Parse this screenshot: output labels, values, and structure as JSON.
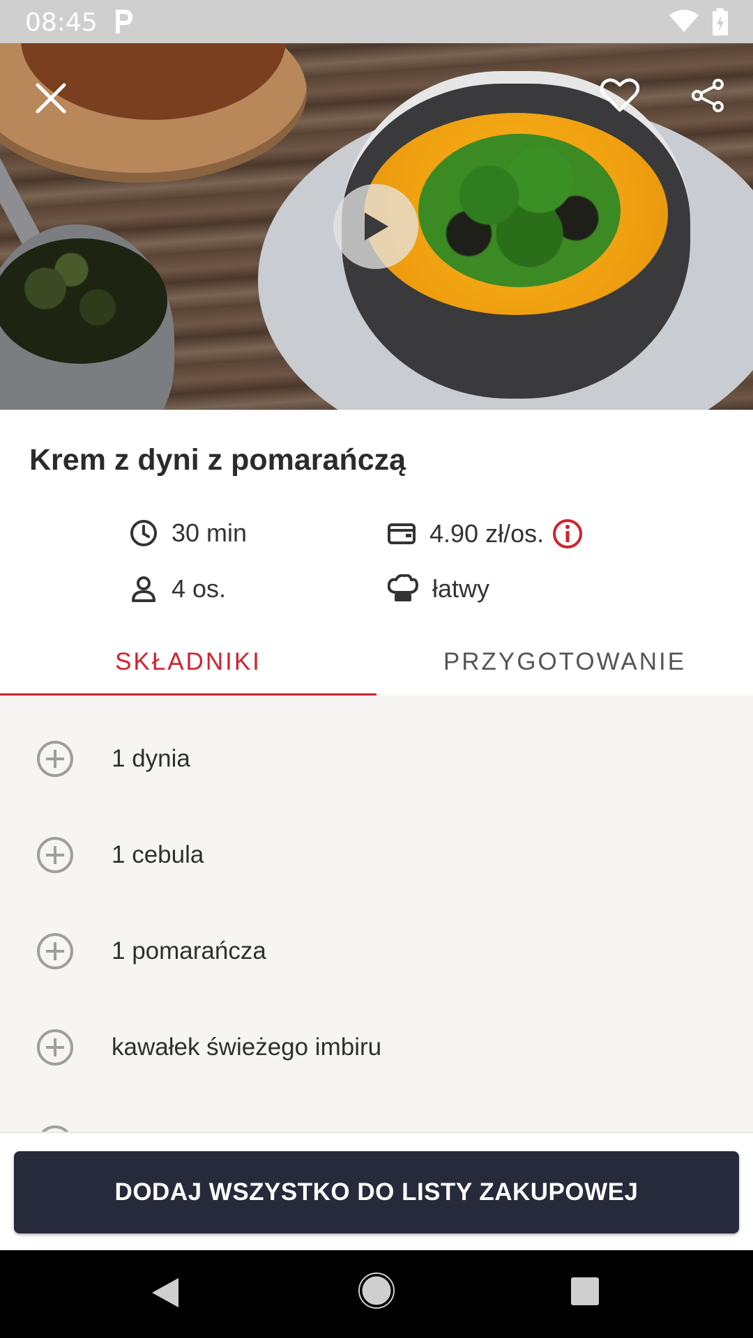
{
  "status_bar": {
    "time": "08:45"
  },
  "hero": {
    "close_icon": "close-icon",
    "favorite_icon": "heart-outline-icon",
    "share_icon": "share-icon",
    "play_icon": "play-icon"
  },
  "recipe": {
    "title": "Krem z dyni z pomarańczą",
    "time": "30 min",
    "cost": "4.90 zł/os.",
    "servings": "4 os.",
    "difficulty": "łatwy"
  },
  "tabs": [
    {
      "label": "SKŁADNIKI",
      "active": true
    },
    {
      "label": "PRZYGOTOWANIE",
      "active": false
    }
  ],
  "ingredients": [
    "1 dynia",
    "1 cebula",
    "1 pomarańcza",
    "kawałek świeżego imbiru"
  ],
  "cta": {
    "label": "DODAJ WSZYSTKO DO LISTY ZAKUPOWEJ"
  },
  "colors": {
    "accent": "#d3212e",
    "button_bg": "#262a3b",
    "list_bg": "#f6f5f4"
  }
}
